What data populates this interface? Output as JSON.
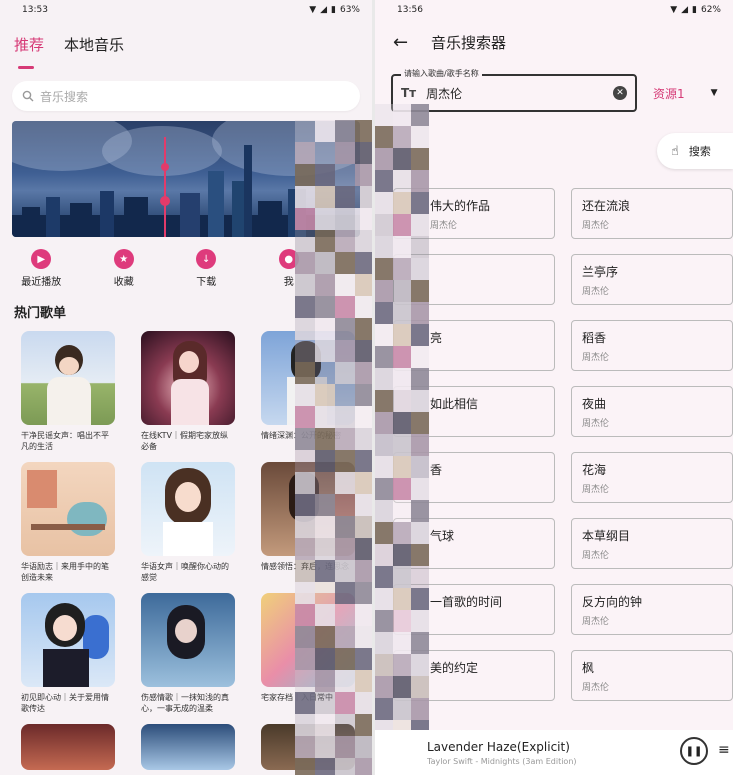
{
  "left": {
    "status": {
      "time": "13:53",
      "battery": "63%"
    },
    "tabs": [
      {
        "label": "推荐"
      },
      {
        "label": "本地音乐"
      }
    ],
    "search_placeholder": "音乐搜索",
    "shortcuts": [
      {
        "label": "最近播放",
        "icon": "play-icon"
      },
      {
        "label": "收藏",
        "icon": "star-icon"
      },
      {
        "label": "下载",
        "icon": "download-icon"
      },
      {
        "label": "我",
        "icon": "user-icon"
      }
    ],
    "section_title": "热门歌单",
    "playlists": [
      {
        "caption": "干净民谣女声：唱出不平凡的生活"
      },
      {
        "caption": "在线KTV｜假期宅家放纵必备"
      },
      {
        "caption": "情绪深渊：公开的秘密"
      },
      {
        "caption": "华语励志｜来用手中的笔创造未来"
      },
      {
        "caption": "华语女声｜唤醒你心动的感觉"
      },
      {
        "caption": "情感领悟：弃后，连思念"
      },
      {
        "caption": "初见即心动｜关于爱用情歌传达"
      },
      {
        "caption": "伤感情歌｜一抹知浅的真心，一事无成的温柔"
      },
      {
        "caption": "宅家存档｜入日常中"
      },
      {
        "caption": ""
      },
      {
        "caption": ""
      },
      {
        "caption": ""
      }
    ],
    "colors": {
      "accent": "#d63a76"
    }
  },
  "right": {
    "status": {
      "time": "13:56",
      "battery": "62%"
    },
    "title": "音乐搜索器",
    "input_label": "请输入歌曲/歌手名称",
    "input_value": "周杰伦",
    "source": "资源1",
    "search_button": "搜索",
    "results": [
      {
        "title": "伟大的作品",
        "artist": "周杰伦"
      },
      {
        "title": "还在流浪",
        "artist": "周杰伦"
      },
      {
        "title": "",
        "artist": ""
      },
      {
        "title": "兰亭序",
        "artist": "周杰伦"
      },
      {
        "title": "亮",
        "artist": ""
      },
      {
        "title": "稻香",
        "artist": "周杰伦"
      },
      {
        "title": "如此相信",
        "artist": ""
      },
      {
        "title": "夜曲",
        "artist": "周杰伦"
      },
      {
        "title": "香",
        "artist": ""
      },
      {
        "title": "花海",
        "artist": "周杰伦"
      },
      {
        "title": "气球",
        "artist": ""
      },
      {
        "title": "本草纲目",
        "artist": "周杰伦"
      },
      {
        "title": "一首歌的时间",
        "artist": ""
      },
      {
        "title": "反方向的钟",
        "artist": "周杰伦"
      },
      {
        "title": "美的约定",
        "artist": ""
      },
      {
        "title": "枫",
        "artist": "周杰伦"
      }
    ],
    "player": {
      "title": "Lavender Haze(Explicit)",
      "subtitle": "Taylor Swift - Midnights (3am Edition)"
    }
  }
}
